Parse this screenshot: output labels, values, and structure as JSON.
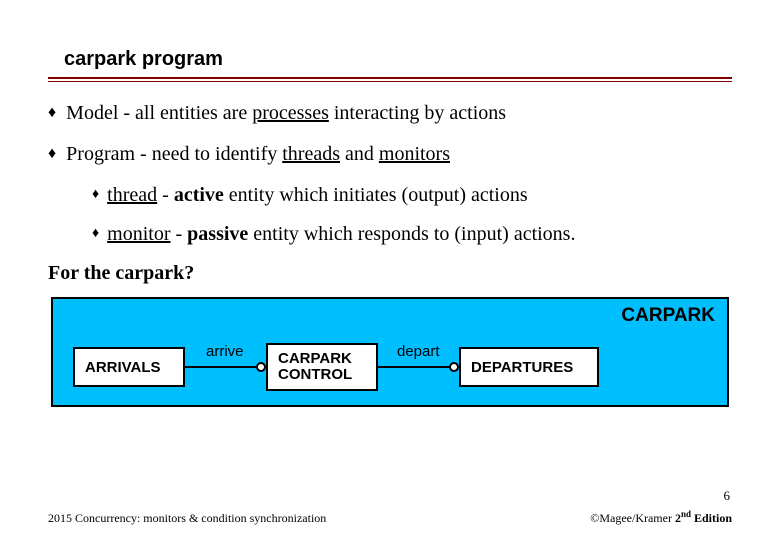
{
  "title": "carpark program",
  "bullets": {
    "b1_pre": "Model - all entities are ",
    "b1_ul": "processes",
    "b1_post": " interacting by actions",
    "b2_pre": "Program - need to identify ",
    "b2_ul1": "threads",
    "b2_mid": " and ",
    "b2_ul2": "monitors",
    "s1_ul": "thread",
    "s1_rest_pre": " - ",
    "s1_bold": "active",
    "s1_rest_post": " entity which initiates (output) actions",
    "s2_ul": "monitor",
    "s2_rest_pre": " - ",
    "s2_bold": "passive",
    "s2_rest_post": " entity which responds to (input) actions."
  },
  "question": "For the carpark?",
  "diagram": {
    "header": "CARPARK",
    "arrivals": "ARRIVALS",
    "arrive": "arrive",
    "control_l1": "CARPARK",
    "control_l2": "CONTROL",
    "depart": "depart",
    "departures": "DEPARTURES"
  },
  "footer": {
    "left": "2015  Concurrency: monitors & condition synchronization",
    "copyright_pre": "©Magee/Kramer ",
    "edition_num": "2",
    "edition_sup": "nd",
    "edition_post": " Edition",
    "page": "6"
  }
}
